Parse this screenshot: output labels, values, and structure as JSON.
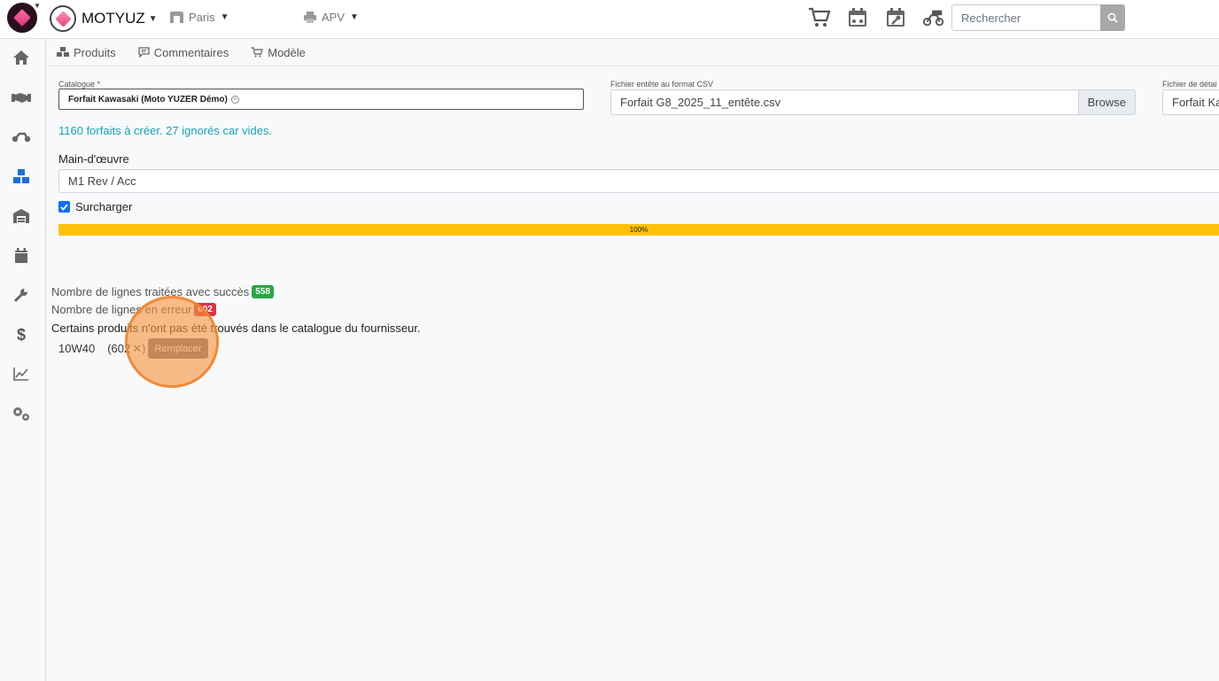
{
  "header": {
    "brand": "MOTYUZ",
    "location": "Paris",
    "department": "APV",
    "search_placeholder": "Rechercher",
    "icons": [
      "cart-icon",
      "calendar-bike-icon",
      "calendar-wrench-icon",
      "motorcycle-cart-icon"
    ]
  },
  "sidebar": {
    "items": [
      "home-icon",
      "handshake-icon",
      "motorcycle-icon",
      "cubes-icon",
      "warehouse-icon",
      "calendar-icon",
      "wrench-icon",
      "dollar-icon",
      "chart-line-icon",
      "cogs-icon"
    ]
  },
  "tabs": [
    {
      "label": "Produits",
      "icon": "cubes-icon"
    },
    {
      "label": "Commentaires",
      "icon": "comment-icon"
    },
    {
      "label": "Modèle",
      "icon": "cart-icon"
    }
  ],
  "form": {
    "catalogue_label": "Catalogue *",
    "catalogue_value": "Forfait Kawasaki (Moto YUZER Démo)",
    "header_file_label": "Fichier entête au format CSV",
    "header_file_value": "Forfait G8_2025_11_entête.csv",
    "browse_label": "Browse",
    "detail_file_label": "Fichier de détai",
    "detail_file_value": "Forfait Ka",
    "info": "1160 forfaits à créer. 27 ignorés car vides.",
    "labour_label": "Main-d'œuvre",
    "labour_value": "M1 Rev / Acc",
    "override_label": "Surcharger",
    "override_checked": true,
    "progress_label": "100%",
    "progress_value": 1.0
  },
  "results": {
    "success_label": "Nombre de lignes traitées avec succès",
    "success_count": "558",
    "error_label": "Nombre de lignes en erreur",
    "error_count": "602",
    "warning": "Certains produits n'ont pas été trouvés dans le catalogue du fournisseur.",
    "missing_items": [
      {
        "code": "10W40",
        "count": "(602",
        "remove": "✕)",
        "action": "Remplacer"
      }
    ]
  },
  "colors": {
    "progress": "#ffc107",
    "success": "#28a745",
    "danger": "#dc3545",
    "info": "#17a2b8",
    "highlight": "#f79440"
  }
}
